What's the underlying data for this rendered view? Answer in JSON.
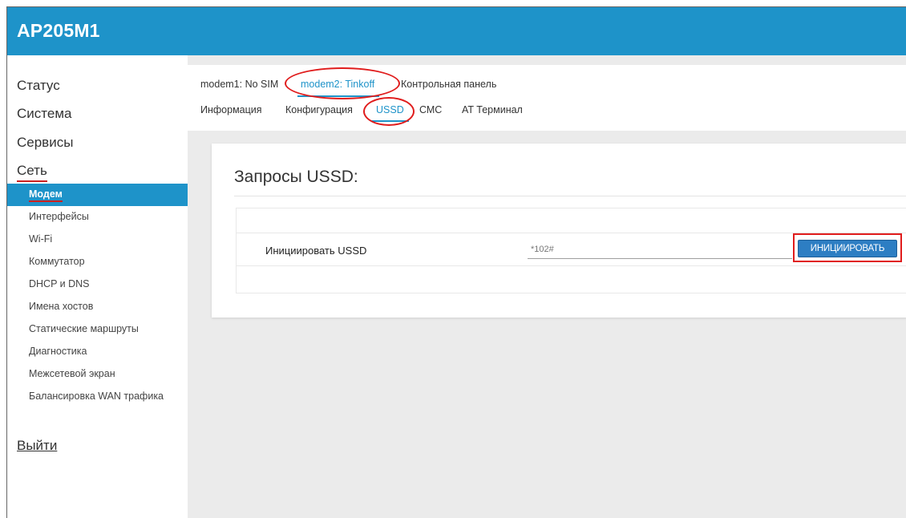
{
  "app": {
    "title": "AP205M1"
  },
  "sidebar": {
    "top": [
      {
        "label": "Статус"
      },
      {
        "label": "Система"
      },
      {
        "label": "Сервисы"
      },
      {
        "label": "Сеть"
      }
    ],
    "sub": [
      {
        "label": "Модем"
      },
      {
        "label": "Интерфейсы"
      },
      {
        "label": "Wi-Fi"
      },
      {
        "label": "Коммутатор"
      },
      {
        "label": "DHCP и DNS"
      },
      {
        "label": "Имена хостов"
      },
      {
        "label": "Статические маршруты"
      },
      {
        "label": "Диагностика"
      },
      {
        "label": "Межсетевой экран"
      },
      {
        "label": "Балансировка WAN трафика"
      }
    ],
    "logout": "Выйти"
  },
  "tabs": {
    "modems": [
      {
        "label": "modem1: No SIM"
      },
      {
        "label": "modem2: Tinkoff"
      },
      {
        "label": "Контрольная панель"
      }
    ],
    "sections": [
      {
        "label": "Информация"
      },
      {
        "label": "Конфигурация"
      },
      {
        "label": "USSD"
      },
      {
        "label": "СМС"
      },
      {
        "label": "AT Терминал"
      }
    ]
  },
  "ussd": {
    "title": "Запросы USSD:",
    "field_label": "Инициировать USSD",
    "input_value": "*102#",
    "button_label": "ИНИЦИИРОВАТЬ"
  },
  "colors": {
    "accent": "#1e93c9",
    "button": "#2d7ec3",
    "highlight": "#e01c1c"
  }
}
